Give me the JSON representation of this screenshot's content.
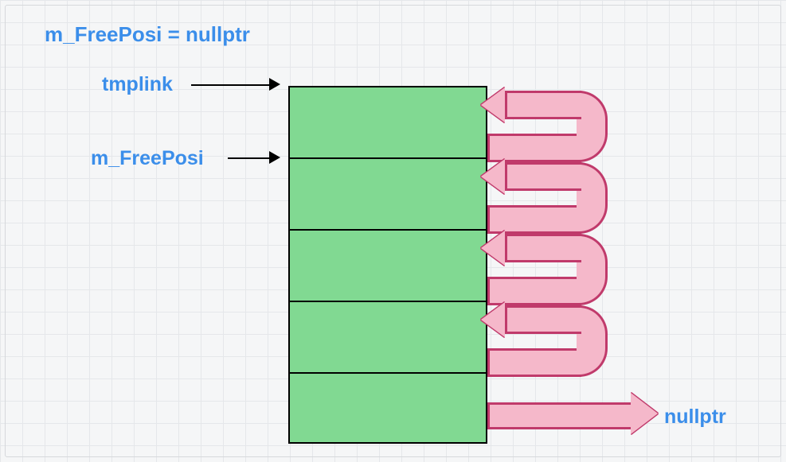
{
  "title_text": "m_FreePosi = nullptr",
  "label_tmplink": "tmplink",
  "label_freeposi": "m_FreePosi",
  "label_nullptr": "nullptr",
  "blocks": {
    "count": 5
  },
  "uturns": {
    "count": 4
  },
  "colors": {
    "label": "#3b8eea",
    "block_fill": "#81d992",
    "pipe_fill": "#f5b8ca",
    "pipe_stroke": "#c03a6b"
  }
}
